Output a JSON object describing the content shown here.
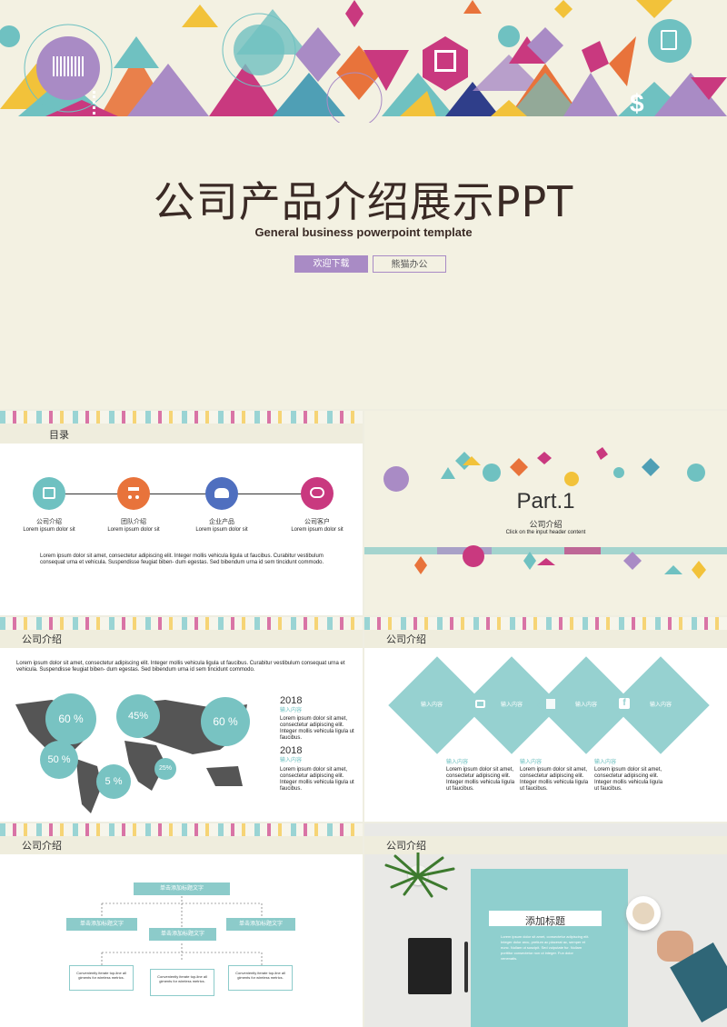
{
  "cover": {
    "title": "公司产品介绍展示PPT",
    "subtitle": "General business powerpoint template",
    "btn_primary": "欢迎下载",
    "btn_secondary": "熊猫办公"
  },
  "toc": {
    "header": "目录",
    "items": [
      {
        "label": "公司介绍",
        "sub": "Lorem ipsum dolor sit",
        "color": "#6fc1c1",
        "icon": "calendar-icon"
      },
      {
        "label": "团队介绍",
        "sub": "Lorem ipsum dolor sit",
        "color": "#e8733b",
        "icon": "org-chart-icon"
      },
      {
        "label": "企业产品",
        "sub": "Lorem ipsum dolor sit",
        "color": "#4f6fbf",
        "icon": "users-icon"
      },
      {
        "label": "公司客户",
        "sub": "Lorem ipsum dolor sit",
        "color": "#c9397f",
        "icon": "chat-icon"
      }
    ],
    "body": "Lorem ipsum dolor sit amet, consectetur adipiscing elit. Integer mollis vehicula ligula ut faucibus. Curabitur vestibulum consequat urna et vehicula. Suspendisse feugiat biben- dum egestas. Sed bibendum urna id sem tincidunt commodo."
  },
  "part": {
    "title": "Part.1",
    "subtitle": "公司介绍",
    "caption": "Click on the input header content"
  },
  "map_slide": {
    "header": "公司介绍",
    "body": "Lorem ipsum dolor sit amet, consectetur adipiscing elit. Integer mollis vehicula ligula ut faucibus. Curabitur vestibulum consequat urna et vehicula. Suspendisse feugiat biben- dum egestas. Sed bibendum urna id sem tincidunt commodo.",
    "bubbles": [
      "60 %",
      "45%",
      "60 %",
      "50 %",
      "5 %",
      "25%"
    ],
    "entries": [
      {
        "year": "2018",
        "label": "输入内容",
        "text": "Lorem ipsum dolor sit amet, consectetur adipiscing elit. Integer mollis vehicula ligula ut faucibus."
      },
      {
        "year": "2018",
        "label": "输入内容",
        "text": "Lorem ipsum dolor sit amet, consectetur adipiscing elit. Integer mollis vehicula ligula ut faucibus."
      }
    ]
  },
  "diamond_slide": {
    "header": "公司介绍",
    "diamonds": [
      "输入内容",
      "输入内容",
      "输入内容",
      "输入内容"
    ],
    "icons": [
      "camera-icon",
      "film-icon",
      "facebook-icon"
    ],
    "columns": [
      {
        "label": "输入内容",
        "text": "Lorem ipsum dolor sit amet, consectetur adipiscing elit. Integer mollis vehicula ligula ut faucibus."
      },
      {
        "label": "输入内容",
        "text": "Lorem ipsum dolor sit amet, consectetur adipiscing elit. Integer mollis vehicula ligula ut faucibus."
      },
      {
        "label": "输入内容",
        "text": "Lorem ipsum dolor sit amet, consectetur adipiscing elit. Integer mollis vehicula ligula ut faucibus."
      }
    ]
  },
  "org_slide": {
    "header": "公司介绍",
    "top": "单击添加标题文字",
    "left": "单击添加标题文字",
    "center": "单击添加标题文字",
    "right": "单击添加标题文字",
    "bottom": [
      "Conveniently iterate top-line all giments for wireless metrics.",
      "Conveniently iterate top-line all giments for wireless metrics.",
      "Conveniently iterate top-line all giments for wireless metrics."
    ]
  },
  "photo_slide": {
    "header": "公司介绍",
    "title": "添加标题",
    "body": "Lorem ipsum dolor sit amet, consectetur adipiscing elit. Integer dolor arcu, pretium ac placerat ac, semper et nunc. Nullam ut suscipit. Sed vulputate fur. Nullam porttitor consectetur non ut integer. Fun dolor venenatis."
  },
  "colors": {
    "teal": "#6fc1c1",
    "purple": "#a98bc5",
    "cream": "#f3f1e2",
    "dark": "#3a2a25"
  }
}
